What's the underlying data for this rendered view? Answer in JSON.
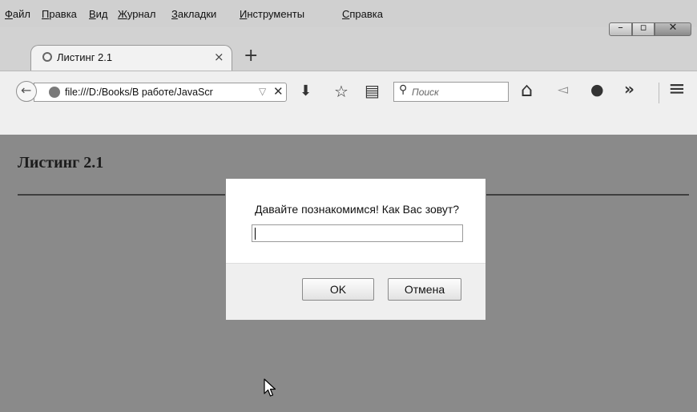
{
  "menu": [
    {
      "first": "Ф",
      "rest": "айл"
    },
    {
      "first": "П",
      "rest": "равка"
    },
    {
      "first": "В",
      "rest": "ид"
    },
    {
      "first": "Ж",
      "rest": "урнал"
    },
    {
      "first": "З",
      "rest": "акладки"
    },
    {
      "first": "И",
      "rest": "нструменты"
    },
    {
      "first": "С",
      "rest": "правка"
    }
  ],
  "window_controls": {
    "minimize": "–",
    "maximize": "▫",
    "close": "✕"
  },
  "tab": {
    "title": "Листинг 2.1",
    "close": "×",
    "new_tab": "+"
  },
  "navbar": {
    "back": "←",
    "url": "file:///D:/Books/В работе/JavaScr",
    "dropdown": "▽",
    "stop": "✕",
    "search_placeholder": "Поиск",
    "search_glyph": "⚲",
    "download": "⬇",
    "bookmark": "☆",
    "reading_list": "▤",
    "home": "⌂",
    "send": "◅",
    "chat": "●",
    "overflow": "»",
    "menu": "≡"
  },
  "page": {
    "heading": "Листинг 2.1"
  },
  "dialog": {
    "message": "Давайте познакомимся! Как Вас зовут?",
    "input_value": "",
    "ok_label": "OK",
    "cancel_label": "Отмена"
  }
}
